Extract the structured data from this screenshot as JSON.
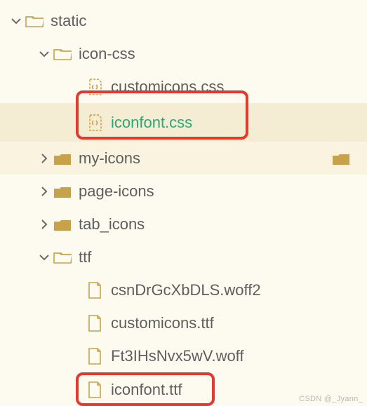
{
  "tree": {
    "root": {
      "label": "static"
    },
    "iconcss": {
      "label": "icon-css"
    },
    "customicons_css": {
      "label": "customicons.css"
    },
    "iconfont_css": {
      "label": "iconfont.css"
    },
    "myicons": {
      "label": "my-icons"
    },
    "pageicons": {
      "label": "page-icons"
    },
    "tabicons": {
      "label": "tab_icons"
    },
    "ttf": {
      "label": "ttf"
    },
    "csn": {
      "label": "csnDrGcXbDLS.woff2"
    },
    "customicons_ttf": {
      "label": "customicons.ttf"
    },
    "ft3": {
      "label": "Ft3IHsNvx5wV.woff"
    },
    "iconfont_ttf": {
      "label": "iconfont.ttf"
    }
  },
  "watermark": "CSDN @_Jyann_"
}
